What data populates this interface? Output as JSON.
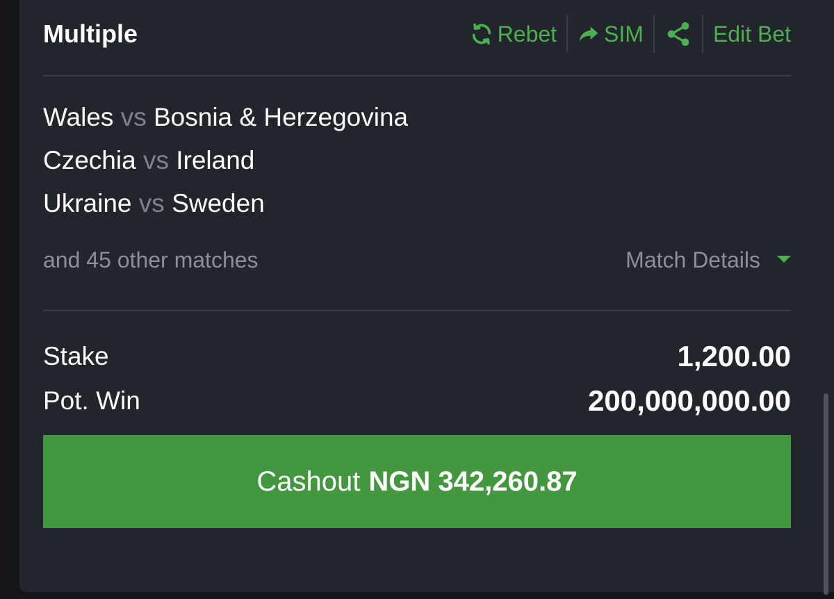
{
  "bet": {
    "title": "Multiple",
    "actions": {
      "rebet_label": "Rebet",
      "sim_label": "SIM",
      "edit_label": "Edit Bet"
    },
    "matches": [
      {
        "home": "Wales",
        "vs": "vs",
        "away": "Bosnia & Herzegovina"
      },
      {
        "home": "Czechia",
        "vs": "vs",
        "away": "Ireland"
      },
      {
        "home": "Ukraine",
        "vs": "vs",
        "away": "Sweden"
      }
    ],
    "other_matches": "and 45 other matches",
    "match_details_label": "Match Details",
    "stake_label": "Stake",
    "stake_value": "1,200.00",
    "pot_win_label": "Pot. Win",
    "pot_win_value": "200,000,000.00",
    "cashout_label": "Cashout",
    "cashout_amount": "NGN 342,260.87"
  },
  "icons": {
    "rebet": "refresh-icon",
    "sim": "share-arrow-icon",
    "share": "share-nodes-icon",
    "details": "caret-down-icon"
  },
  "colors": {
    "accent": "#4caf50",
    "cashout_bg": "#43973f",
    "card_bg": "#22252c",
    "page_bg": "#14161b"
  }
}
